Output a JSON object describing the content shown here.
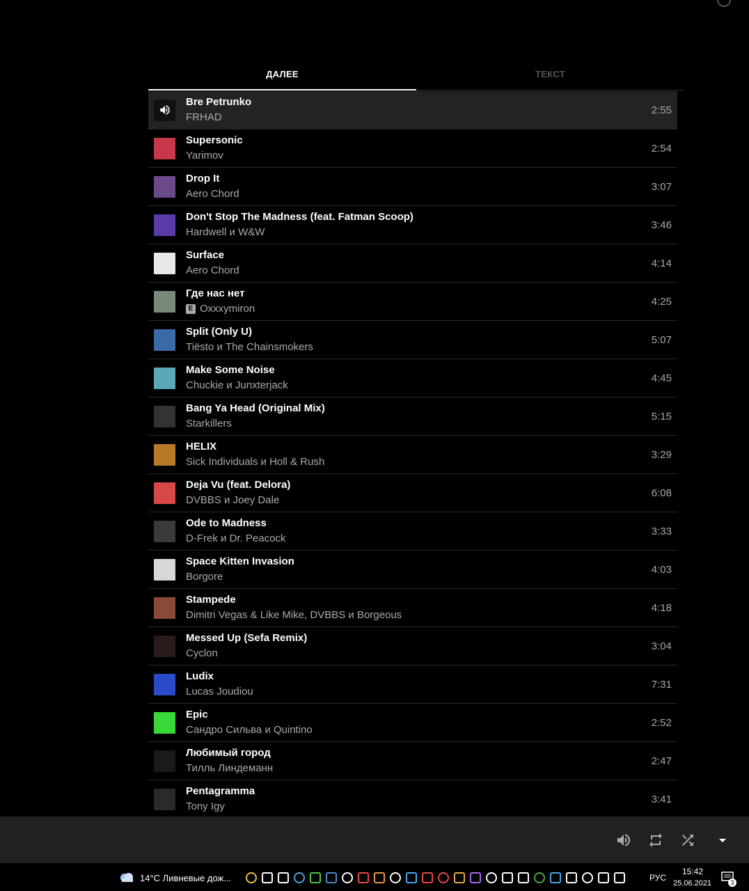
{
  "tabs": [
    {
      "label": "ДАЛЕЕ",
      "active": true
    },
    {
      "label": "ТЕКСТ",
      "active": false
    }
  ],
  "queue": [
    {
      "title": "Bre Petrunko",
      "artist": "FRHAD",
      "duration": "2:55",
      "current": true,
      "thumb_color": "#111111"
    },
    {
      "title": "Supersonic",
      "artist": "Yarimov",
      "duration": "2:54",
      "thumb_color": "#c8384a"
    },
    {
      "title": "Drop It",
      "artist": "Aero Chord",
      "duration": "3:07",
      "thumb_color": "#6b4a8c"
    },
    {
      "title": "Don't Stop The Madness (feat. Fatman Scoop)",
      "artist": "Hardwell и W&W",
      "duration": "3:46",
      "thumb_color": "#5b3aa8"
    },
    {
      "title": "Surface",
      "artist": "Aero Chord",
      "duration": "4:14",
      "thumb_color": "#e8e8e8"
    },
    {
      "title": "Где нас нет",
      "artist": "Oxxxymiron",
      "explicit": "E",
      "duration": "4:25",
      "thumb_color": "#7a8a7a"
    },
    {
      "title": "Split (Only U)",
      "artist": "Tiësto и The Chainsmokers",
      "duration": "5:07",
      "thumb_color": "#3a6aa8"
    },
    {
      "title": "Make Some Noise",
      "artist": "Chuckie и Junxterjack",
      "duration": "4:45",
      "thumb_color": "#5aa8b8"
    },
    {
      "title": "Bang Ya Head (Original Mix)",
      "artist": "Starkillers",
      "duration": "5:15",
      "thumb_color": "#333333"
    },
    {
      "title": "HELIX",
      "artist": "Sick Individuals и Holl & Rush",
      "duration": "3:29",
      "thumb_color": "#b87a28"
    },
    {
      "title": "Deja Vu (feat. Delora)",
      "artist": "DVBBS и Joey Dale",
      "duration": "6:08",
      "thumb_color": "#d84848"
    },
    {
      "title": "Ode to Madness",
      "artist": "D-Frek и Dr. Peacock",
      "duration": "3:33",
      "thumb_color": "#3a3a3a"
    },
    {
      "title": "Space Kitten Invasion",
      "artist": "Borgore",
      "duration": "4:03",
      "thumb_color": "#d8d8d8"
    },
    {
      "title": "Stampede",
      "artist": "Dimitri Vegas & Like Mike, DVBBS и Borgeous",
      "duration": "4:18",
      "thumb_color": "#8a4a3a"
    },
    {
      "title": "Messed Up (Sefa Remix)",
      "artist": "Cyclon",
      "duration": "3:04",
      "thumb_color": "#2a1a1a"
    },
    {
      "title": "Ludix",
      "artist": "Lucas Joudiou",
      "duration": "7:31",
      "thumb_color": "#2a4ac8"
    },
    {
      "title": "Epic",
      "artist": "Сандро Сильва и Quintino",
      "duration": "2:52",
      "thumb_color": "#38d838"
    },
    {
      "title": "Любимый город",
      "artist": "Тилль Линдеманн",
      "duration": "2:47",
      "thumb_color": "#1a1a1a"
    },
    {
      "title": "Pentagramma",
      "artist": "Tony Igy",
      "duration": "3:41",
      "thumb_color": "#2a2a2a"
    }
  ],
  "player": {
    "controls": [
      "volume-icon",
      "repeat-icon",
      "shuffle-icon",
      "expand-icon"
    ]
  },
  "taskbar": {
    "weather": "14°C  Ливневые дож...",
    "language": "РУС",
    "time": "15:42",
    "date": "25.06.2021",
    "notifications": "3",
    "tray_colors": [
      "#e8c040",
      "#ffffff",
      "#ffffff",
      "#48a8d8",
      "#48c848",
      "#4a8ac8",
      "#ffffff",
      "#e84848",
      "#e89848",
      "#ffffff",
      "#48a8e8",
      "#e84848",
      "#e84848",
      "#e8a848",
      "#a868e8",
      "#ffffff",
      "#ffffff",
      "#ffffff",
      "#48a848",
      "#48a8e8",
      "#ffffff",
      "#ffffff",
      "#ffffff",
      "#ffffff"
    ]
  }
}
